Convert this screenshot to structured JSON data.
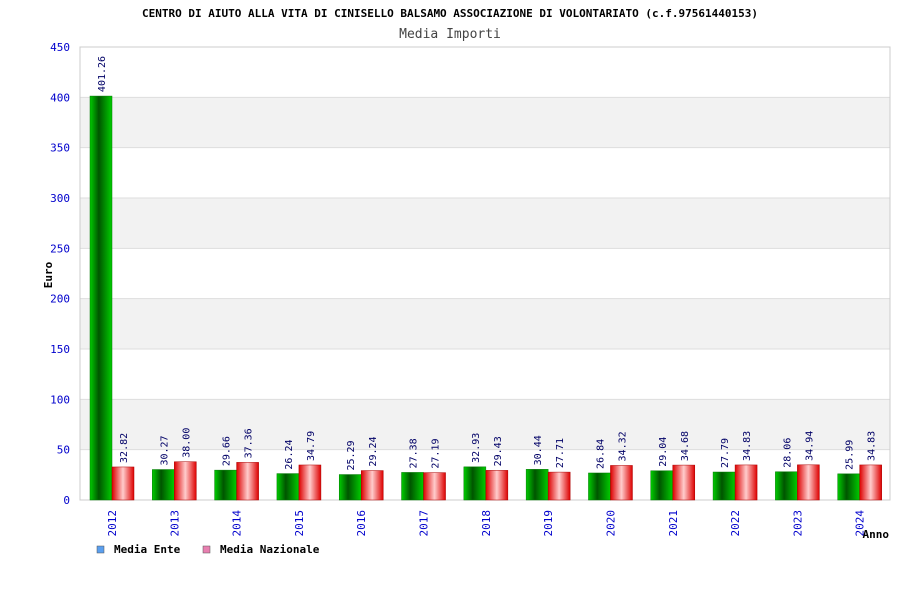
{
  "chart_data": {
    "type": "bar",
    "title": "CENTRO DI AIUTO ALLA VITA DI CINISELLO BALSAMO ASSOCIAZIONE DI VOLONTARIATO (c.f.97561440153)",
    "subtitle": "Media Importi",
    "xlabel": "Anno",
    "ylabel": "Euro",
    "ylim": [
      0,
      450
    ],
    "yticks": [
      0,
      50,
      100,
      150,
      200,
      250,
      300,
      350,
      400,
      450
    ],
    "categories": [
      "2012",
      "2013",
      "2014",
      "2015",
      "2016",
      "2017",
      "2018",
      "2019",
      "2020",
      "2021",
      "2022",
      "2023",
      "2024"
    ],
    "series": [
      {
        "name": "Media Ente",
        "legend_color": "#5a9fef",
        "values": [
          401.26,
          30.27,
          29.66,
          26.24,
          25.29,
          27.38,
          32.93,
          30.44,
          26.84,
          29.04,
          27.79,
          28.06,
          25.99
        ],
        "labels": [
          "401.26",
          "30.27",
          "29.66",
          "26.24",
          "25.29",
          "27.38",
          "32.93",
          "30.44",
          "26.84",
          "29.04",
          "27.79",
          "28.06",
          "25.99"
        ]
      },
      {
        "name": "Media Nazionale",
        "legend_color": "#e87fb0",
        "values": [
          32.82,
          38.0,
          37.36,
          34.79,
          29.24,
          27.19,
          29.43,
          27.71,
          34.32,
          34.68,
          34.83,
          34.94,
          34.83
        ],
        "labels": [
          "32.82",
          "38.00",
          "37.36",
          "34.79",
          "29.24",
          "27.19",
          "29.43",
          "27.71",
          "34.32",
          "34.68",
          "34.83",
          "34.94",
          "34.83"
        ]
      }
    ],
    "grid": true,
    "band_colors": [
      "#ffffff",
      "#f2f2f2"
    ],
    "legend_position": "bottom-left"
  }
}
